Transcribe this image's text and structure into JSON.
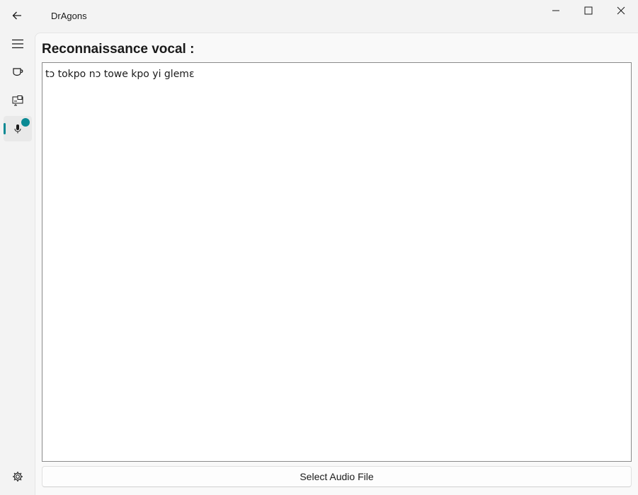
{
  "app": {
    "title": "DrAgons"
  },
  "nav": {
    "items": [
      {
        "icon": "hamburger-menu-icon"
      },
      {
        "icon": "cup-icon"
      },
      {
        "icon": "translate-screen-icon"
      },
      {
        "icon": "microphone-icon",
        "selected": true,
        "badge": true
      }
    ],
    "settings_icon": "gear-icon",
    "accent_color": "#0a8a94"
  },
  "main": {
    "heading": "Reconnaissance vocal :",
    "transcript_text": "tɔ tokpo nɔ towe kpo yi glemɛ",
    "select_button_label": "Select Audio File"
  }
}
